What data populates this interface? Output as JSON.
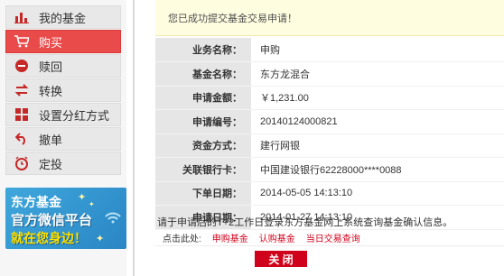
{
  "sidebar": {
    "items": [
      {
        "label": "我的基金",
        "icon": "bar-chart-icon"
      },
      {
        "label": "购买",
        "icon": "cart-icon"
      },
      {
        "label": "赎回",
        "icon": "redeem-icon"
      },
      {
        "label": "转换",
        "icon": "convert-icon"
      },
      {
        "label": "设置分红方式",
        "icon": "grid-icon"
      },
      {
        "label": "撤单",
        "icon": "undo-icon"
      },
      {
        "label": "定投",
        "icon": "alarm-clock-icon"
      }
    ],
    "active_index": 1,
    "banner": {
      "line1": "东方基金",
      "line2": "官方微信平台",
      "line3": "就在您身边！"
    }
  },
  "notice": "您已成功提交基金交易申请！",
  "details": [
    {
      "label": "业务名称：",
      "value": "申购"
    },
    {
      "label": "基金名称：",
      "value": "东方龙混合"
    },
    {
      "label": "申请金额：",
      "value": "￥1,231.00"
    },
    {
      "label": "申请编号：",
      "value": "20140124000821"
    },
    {
      "label": "资金方式：",
      "value": "建行网银"
    },
    {
      "label": "关联银行卡：",
      "value": "中国建设银行62228000****0088"
    },
    {
      "label": "下单日期：",
      "value": "2014-05-05 14:13:10"
    },
    {
      "label": "申请日期：",
      "value": "2014-01-27 14:13:10"
    }
  ],
  "tip": "请于申请后的T+2工作日登录东方基金网上系统查询基金确认信息。",
  "links": {
    "prefix": "点击此处:",
    "items": [
      "申购基金",
      "认购基金",
      "当日交易查询"
    ]
  },
  "close_label": "关 闭",
  "colors": {
    "accent": "#d0021b",
    "active_nav": "#e94b4b",
    "notice_bg": "#fffde0"
  }
}
